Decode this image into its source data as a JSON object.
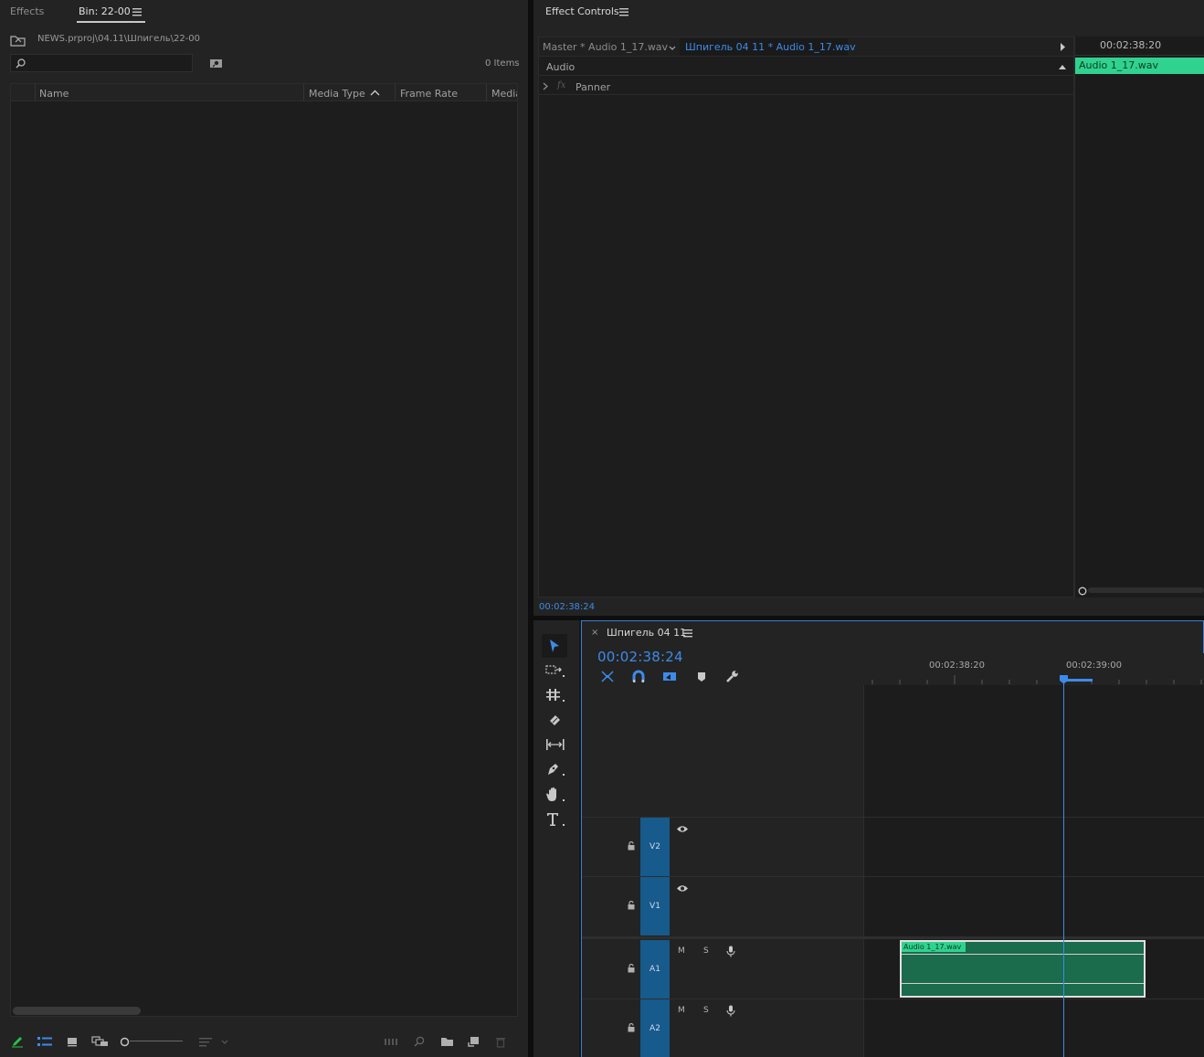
{
  "project_panel": {
    "tabs": [
      {
        "label": "Effects"
      },
      {
        "label": "Bin: 22-00"
      }
    ],
    "path": "NEWS.prproj\\04.11\\Шпигель\\22-00",
    "search_placeholder": "",
    "item_count": "0 Items",
    "columns": [
      "Name",
      "Media Type",
      "Frame Rate",
      "Media"
    ]
  },
  "effect_controls": {
    "title": "Effect Controls",
    "master_label": "Master * Audio 1_17.wav",
    "sequence_clip_label": "Шпигель 04 11 * Audio 1_17.wav",
    "ruler_time": "00:02:38:20",
    "clip_name": "Audio 1_17.wav",
    "section": "Audio",
    "effects": [
      {
        "fx": "fx",
        "name": "Panner"
      }
    ],
    "current_time": "00:02:38:24"
  },
  "timeline": {
    "close_glyph": "×",
    "sequence_name": "Шпигель 04 11",
    "timecode": "00:02:38:24",
    "ruler_ticks": [
      "00:02:38:20",
      "00:02:39:00"
    ],
    "tracks": [
      {
        "label": "V2",
        "type": "video"
      },
      {
        "label": "V1",
        "type": "video"
      },
      {
        "label": "A1",
        "type": "audio",
        "mute": "M",
        "solo": "S"
      },
      {
        "label": "A2",
        "type": "audio",
        "mute": "M",
        "solo": "S"
      }
    ],
    "clips": [
      {
        "name": "Audio 1_17.wav",
        "track": "A1"
      }
    ]
  },
  "colors": {
    "accent_blue": "#3d8be8",
    "track_label_blue": "#175a8c",
    "audio_clip_green": "#1b6b4d",
    "clip_header_green": "#2fd28e"
  }
}
